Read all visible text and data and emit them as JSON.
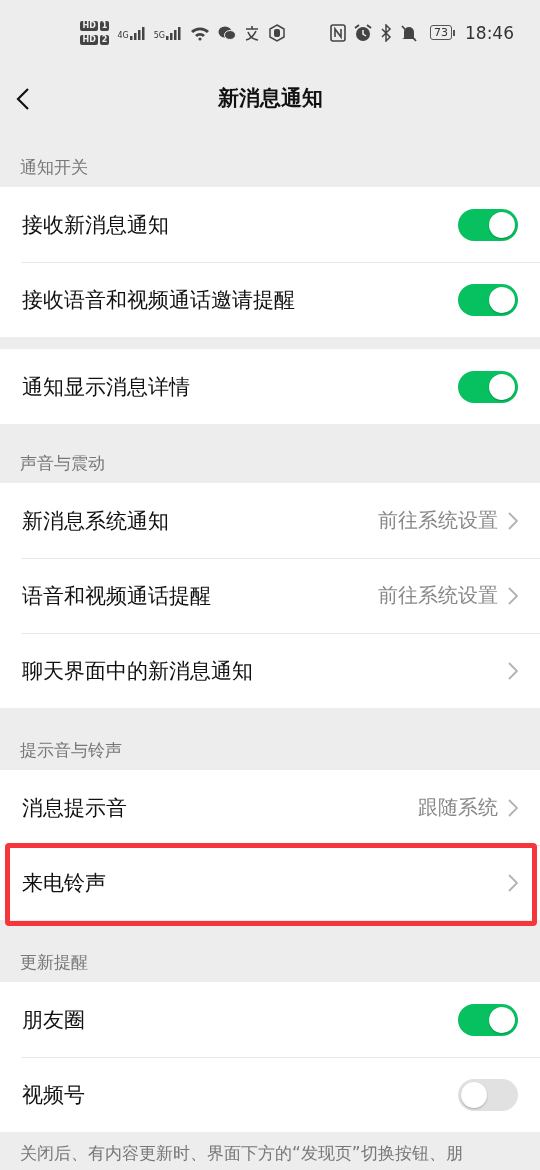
{
  "status_bar": {
    "sim_badges": [
      {
        "label": "HD",
        "slot": "1"
      },
      {
        "label": "HD",
        "slot": "2"
      }
    ],
    "networks": [
      "4G",
      "5G"
    ],
    "battery": "73",
    "time": "18:46"
  },
  "nav": {
    "title": "新消息通知"
  },
  "sections": [
    {
      "header": "通知开关",
      "groups": [
        [
          {
            "kind": "toggle",
            "label": "接收新消息通知",
            "on": true,
            "highlighted": false
          },
          {
            "kind": "toggle",
            "label": "接收语音和视频通话邀请提醒",
            "on": true,
            "highlighted": false
          }
        ],
        [
          {
            "kind": "toggle",
            "label": "通知显示消息详情",
            "on": true,
            "highlighted": false
          }
        ]
      ]
    },
    {
      "header": "声音与震动",
      "groups": [
        [
          {
            "kind": "link",
            "label": "新消息系统通知",
            "value": "前往系统设置",
            "highlighted": false
          },
          {
            "kind": "link",
            "label": "语音和视频通话提醒",
            "value": "前往系统设置",
            "highlighted": false
          },
          {
            "kind": "link",
            "label": "聊天界面中的新消息通知",
            "highlighted": false
          }
        ]
      ]
    },
    {
      "header": "提示音与铃声",
      "groups": [
        [
          {
            "kind": "link",
            "label": "消息提示音",
            "value": "跟随系统",
            "highlighted": false
          },
          {
            "kind": "link",
            "label": "来电铃声",
            "highlighted": true
          }
        ]
      ]
    },
    {
      "header": "更新提醒",
      "groups": [
        [
          {
            "kind": "toggle",
            "label": "朋友圈",
            "on": true,
            "highlighted": false
          },
          {
            "kind": "toggle",
            "label": "视频号",
            "on": false,
            "highlighted": false
          }
        ]
      ]
    }
  ],
  "footer_note": "关闭后、有内容更新时、界面下方的“发现页”切换按钮、朋"
}
